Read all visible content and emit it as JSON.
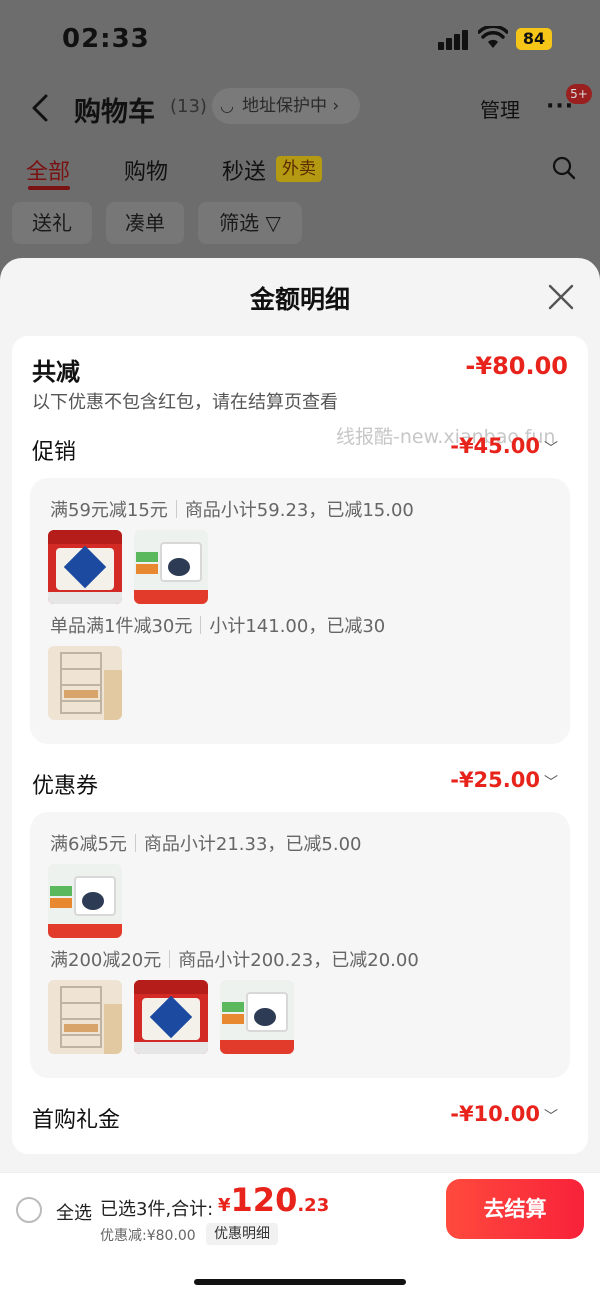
{
  "status_bar": {
    "time": "02:33",
    "battery": "84"
  },
  "header": {
    "title": "购物车",
    "count": "(13)",
    "address_chip": "地址保护中 ›",
    "manage": "管理",
    "more_badge": "5+"
  },
  "tabs": [
    {
      "label": "全部"
    },
    {
      "label": "购物"
    },
    {
      "label": "秒送"
    }
  ],
  "takeout_badge": "外卖",
  "filters": [
    {
      "label": "送礼"
    },
    {
      "label": "凑单"
    },
    {
      "label": "筛选 ▽"
    }
  ],
  "sheet": {
    "title": "金额明细",
    "total_label": "共减",
    "total_amount": "-¥80.00",
    "note": "以下优惠不包含红包，请在结算页查看",
    "watermark": "线报酷-new.xianbao.fun",
    "sections": [
      {
        "label": "促销",
        "amount": "-¥45.00",
        "rules": [
          {
            "condition": "满59元减15元",
            "detail": "商品小计59.23，已减15.00"
          },
          {
            "condition": "单品满1件减30元",
            "detail": "小计141.00，已减30"
          }
        ]
      },
      {
        "label": "优惠券",
        "amount": "-¥25.00",
        "rules": [
          {
            "condition": "满6减5元",
            "detail": "商品小计21.33，已减5.00"
          },
          {
            "condition": "满200减20元",
            "detail": "商品小计200.23，已减20.00"
          }
        ]
      },
      {
        "label": "首购礼金",
        "amount": "-¥10.00"
      }
    ]
  },
  "bottom_bar": {
    "select_all": "全选",
    "selected": "已选3件,合计:",
    "currency": "¥",
    "total_int": "120",
    "total_dec": ".23",
    "discount": "优惠减:¥80.00",
    "detail_chip": "优惠明细",
    "checkout": "去结算"
  },
  "colors": {
    "accent": "#e8231b",
    "checkout": "#f8223a",
    "tab_active": "#e8231b"
  },
  "icons": [
    "back-icon",
    "more-icon",
    "search-icon",
    "filter-icon",
    "close-icon",
    "chevron-down-icon"
  ]
}
